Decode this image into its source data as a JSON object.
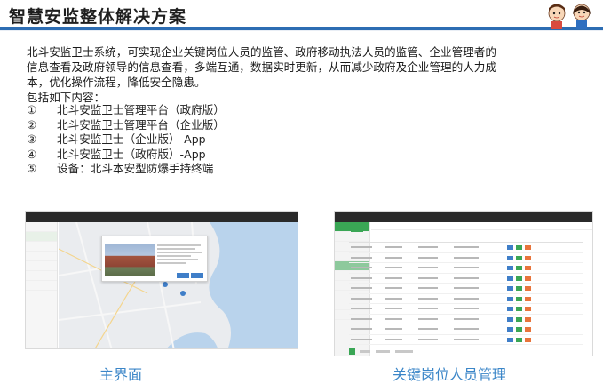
{
  "header": {
    "title": "智慧安监整体解决方案"
  },
  "intro": {
    "paragraph": "北斗安监卫士系统，可实现企业关键岗位人员的监管、政府移动执法人员的监管、企业管理者的信息查看及政府领导的信息查看，多端互通，数据实时更新，从而减少政府及企业管理的人力成本，优化操作流程，降低安全隐患。",
    "list_intro": "包括如下内容："
  },
  "items": [
    {
      "num": "①",
      "text": "北斗安监卫士管理平台（政府版）"
    },
    {
      "num": "②",
      "text": "北斗安监卫士管理平台（企业版）"
    },
    {
      "num": "③",
      "text": "北斗安监卫士（企业版）-App"
    },
    {
      "num": "④",
      "text": "北斗安监卫士（政府版）-App"
    },
    {
      "num": "⑤",
      "text": "设备：北斗本安型防爆手持终端"
    }
  ],
  "screenshots": {
    "left": {
      "caption": "主界面"
    },
    "right": {
      "caption": "关键岗位人员管理"
    }
  },
  "colors": {
    "accent_blue": "#2d6db3",
    "caption_blue": "#3b86c8",
    "sidebar_green": "#3aa655"
  }
}
